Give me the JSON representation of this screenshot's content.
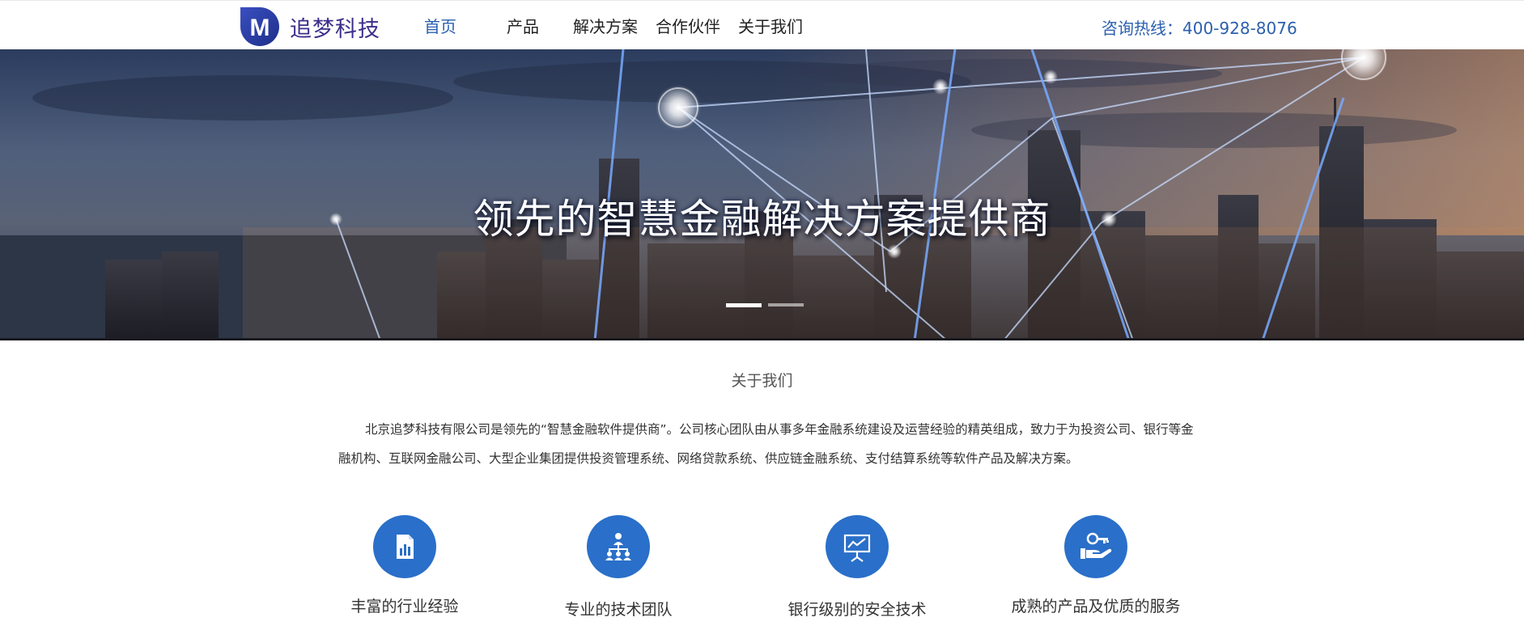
{
  "brand": {
    "name": "追梦科技",
    "logo_letter": "M",
    "color": "#3b2e8a"
  },
  "nav": {
    "items": [
      {
        "label": "首页",
        "active": true
      },
      {
        "label": "产品"
      },
      {
        "label": "解决方案"
      },
      {
        "label": "合作伙伴"
      },
      {
        "label": "关于我们"
      }
    ]
  },
  "hotline": {
    "text": "咨询热线：400-928-8076"
  },
  "banner": {
    "title": "领先的智慧金融解决方案提供商",
    "slides": 2,
    "active_slide": 1
  },
  "about": {
    "title": "关于我们",
    "text": "北京追梦科技有限公司是领先的“智慧金融软件提供商”。公司核心团队由从事多年金融系统建设及运营经验的精英组成，致力于为投资公司、银行等金融机构、互联网金融公司、大型企业集团提供投资管理系统、网络贷款系统、供应链金融系统、支付结算系统等软件产品及解决方案。"
  },
  "features": [
    {
      "label": "丰富的行业经验",
      "icon": "report-chart-icon"
    },
    {
      "label": "专业的技术团队",
      "icon": "team-hierarchy-icon"
    },
    {
      "label": "银行级别的安全技术",
      "icon": "presentation-board-icon"
    },
    {
      "label": "成熟的产品及优质的服务",
      "icon": "key-hand-icon"
    }
  ],
  "colors": {
    "accent": "#2a6fc9",
    "nav_active": "#2a5fae"
  }
}
